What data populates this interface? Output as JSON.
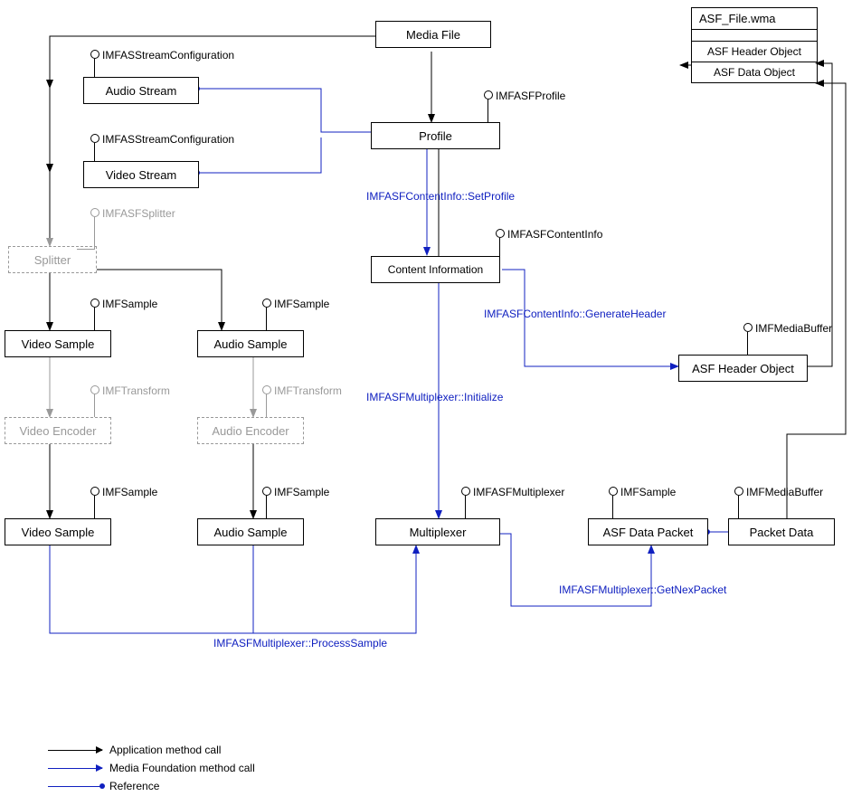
{
  "boxes": {
    "mediaFile": "Media File",
    "audioStream": "Audio Stream",
    "videoStream": "Video Stream",
    "profile": "Profile",
    "splitter": "Splitter",
    "contentInfo": "Content Information",
    "videoSample1": "Video Sample",
    "audioSample1": "Audio Sample",
    "videoEncoder": "Video Encoder",
    "audioEncoder": "Audio Encoder",
    "videoSample2": "Video Sample",
    "audioSample2": "Audio Sample",
    "multiplexer": "Multiplexer",
    "asfDataPacket": "ASF Data Packet",
    "packetData": "Packet Data",
    "asfHeaderObject": "ASF Header Object"
  },
  "asfFile": {
    "title": "ASF_File.wma",
    "row1": "ASF Header Object",
    "row2": "ASF Data Object"
  },
  "interfaces": {
    "imfasStreamConfig1": "IMFASStreamConfiguration",
    "imfasStreamConfig2": "IMFASStreamConfiguration",
    "imfasfProfile": "IMFASFProfile",
    "imfasfSplitter": "IMFASFSplitter",
    "imfasfContentInfo": "IMFASFContentInfo",
    "imfSample1": "IMFSample",
    "imfSample2": "IMFSample",
    "imfTransform1": "IMFTransform",
    "imfTransform2": "IMFTransform",
    "imfSample3": "IMFSample",
    "imfSample4": "IMFSample",
    "imfasfMultiplexer": "IMFASFMultiplexer",
    "imfSample5": "IMFSample",
    "imfMediaBuffer1": "IMFMediaBuffer",
    "imfMediaBuffer2": "IMFMediaBuffer"
  },
  "methods": {
    "setProfile": "IMFASFContentInfo::SetProfile",
    "initialize": "IMFASFMultiplexer::Initialize",
    "generateHeader": "IMFASFContentInfo::GenerateHeader",
    "processSample": "IMFASFMultiplexer::ProcessSample",
    "getNextPacket": "IMFASFMultiplexer::GetNexPacket"
  },
  "legend": {
    "app": "Application method call",
    "mf": "Media Foundation method call",
    "ref": "Reference"
  }
}
